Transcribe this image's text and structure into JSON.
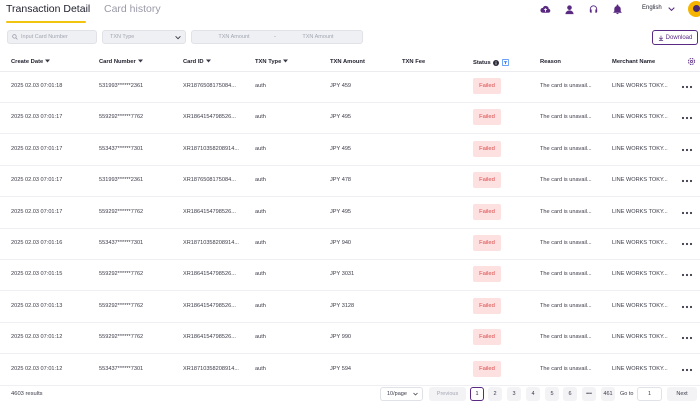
{
  "tabs": {
    "active": "Transaction Detail",
    "inactive": "Card history"
  },
  "header": {
    "language": "English"
  },
  "filters": {
    "card_placeholder": "Input Card Number",
    "txn_type_placeholder": "TXN Type",
    "amount_from_placeholder": "TXN Amount",
    "amount_separator": "-",
    "amount_to_placeholder": "TXN Amount",
    "download_label": "Download"
  },
  "columns": {
    "create_date": "Create Date",
    "card_number": "Card Number",
    "card_id": "Card ID",
    "txn_type": "TXN Type",
    "txn_amount": "TXN Amount",
    "txn_fee": "TXN Fee",
    "status": "Status",
    "reason": "Reason",
    "merchant_name": "Merchant Name"
  },
  "rows": [
    {
      "date": "2025 02.03 07:01:18",
      "card": "531993******2361",
      "card_id": "XR1876508175084...",
      "type": "auth",
      "amount": "JPY 459",
      "fee": "",
      "status": "Failed",
      "reason": "The card is unavail...",
      "merchant": "LINE WORKS TOKY..."
    },
    {
      "date": "2025 02.03 07:01:17",
      "card": "559292******7762",
      "card_id": "XR1864154798526...",
      "type": "auth",
      "amount": "JPY 495",
      "fee": "",
      "status": "Failed",
      "reason": "The card is unavail...",
      "merchant": "LINE WORKS TOKY..."
    },
    {
      "date": "2025 02.03 07:01:17",
      "card": "553437******7301",
      "card_id": "XR187103582089​14...",
      "type": "auth",
      "amount": "JPY 495",
      "fee": "",
      "status": "Failed",
      "reason": "The card is unavail...",
      "merchant": "LINE WORKS TOKY..."
    },
    {
      "date": "2025 02.03 07:01:17",
      "card": "531993******2361",
      "card_id": "XR1876508175084...",
      "type": "auth",
      "amount": "JPY 478",
      "fee": "",
      "status": "Failed",
      "reason": "The card is unavail...",
      "merchant": "LINE WORKS TOKY..."
    },
    {
      "date": "2025 02.03 07:01:17",
      "card": "559292******7762",
      "card_id": "XR1864154798526...",
      "type": "auth",
      "amount": "JPY 495",
      "fee": "",
      "status": "Failed",
      "reason": "The card is unavail...",
      "merchant": "LINE WORKS TOKY..."
    },
    {
      "date": "2025 02.03 07:01:16",
      "card": "553437******7301",
      "card_id": "XR187103582089​14...",
      "type": "auth",
      "amount": "JPY 940",
      "fee": "",
      "status": "Failed",
      "reason": "The card is unavail...",
      "merchant": "LINE WORKS TOKY..."
    },
    {
      "date": "2025 02.03 07:01:15",
      "card": "559292******7762",
      "card_id": "XR1864154798526...",
      "type": "auth",
      "amount": "JPY 3031",
      "fee": "",
      "status": "Failed",
      "reason": "The card is unavail...",
      "merchant": "LINE WORKS TOKY..."
    },
    {
      "date": "2025 02.03 07:01:13",
      "card": "559292******7762",
      "card_id": "XR1864154798526...",
      "type": "auth",
      "amount": "JPY 3128",
      "fee": "",
      "status": "Failed",
      "reason": "The card is unavail...",
      "merchant": "LINE WORKS TOKY..."
    },
    {
      "date": "2025 02.03 07:01:12",
      "card": "559292******7762",
      "card_id": "XR1864154798526...",
      "type": "auth",
      "amount": "JPY 990",
      "fee": "",
      "status": "Failed",
      "reason": "The card is unavail...",
      "merchant": "LINE WORKS TOKY..."
    },
    {
      "date": "2025 02.03 07:01:12",
      "card": "553437******7301",
      "card_id": "XR187103582089​14...",
      "type": "auth",
      "amount": "JPY 594",
      "fee": "",
      "status": "Failed",
      "reason": "The card is unavail...",
      "merchant": "LINE WORKS TOKY..."
    }
  ],
  "pagination": {
    "results": "4603 results",
    "page_size": "10/page",
    "previous": "Previous",
    "pages": [
      "1",
      "2",
      "3",
      "4",
      "5",
      "6",
      "•••",
      "461"
    ],
    "active_page": "1",
    "goto_label": "Go to",
    "goto_value": "1",
    "next": "Next"
  },
  "colors": {
    "accent": "#5a2a82",
    "tab_underline": "#f1c40f",
    "failed_bg": "#fde0e0",
    "failed_text": "#d94a4a"
  },
  "icons": [
    "upload-cloud-icon",
    "user-icon",
    "headset-icon",
    "bell-icon",
    "chevron-down-icon",
    "avatar",
    "search-icon",
    "download-icon",
    "info-icon",
    "filter-icon",
    "gear-icon",
    "more-dots-icon"
  ]
}
